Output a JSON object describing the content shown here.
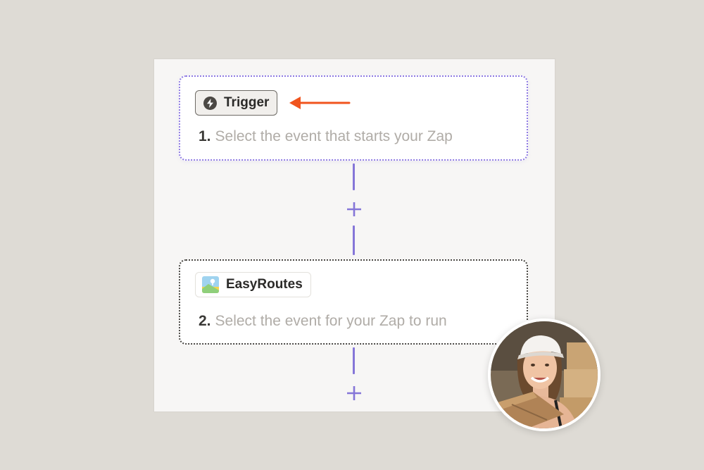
{
  "steps": [
    {
      "number": "1.",
      "chip_label": "Trigger",
      "chip_icon": "bolt-icon",
      "description": "Select the event that starts your Zap"
    },
    {
      "number": "2.",
      "chip_label": "EasyRoutes",
      "chip_icon": "easyroutes-app-icon",
      "description": "Select the event for your Zap to run"
    }
  ],
  "colors": {
    "page_background": "#dedbd5",
    "canvas_background": "#f7f6f5",
    "trigger_border": "#8f7be3",
    "action_border": "#4a4844",
    "connector": "#8576d8",
    "arrow": "#f0541e"
  },
  "avatar": {
    "icon": "user-photo-avatar"
  }
}
